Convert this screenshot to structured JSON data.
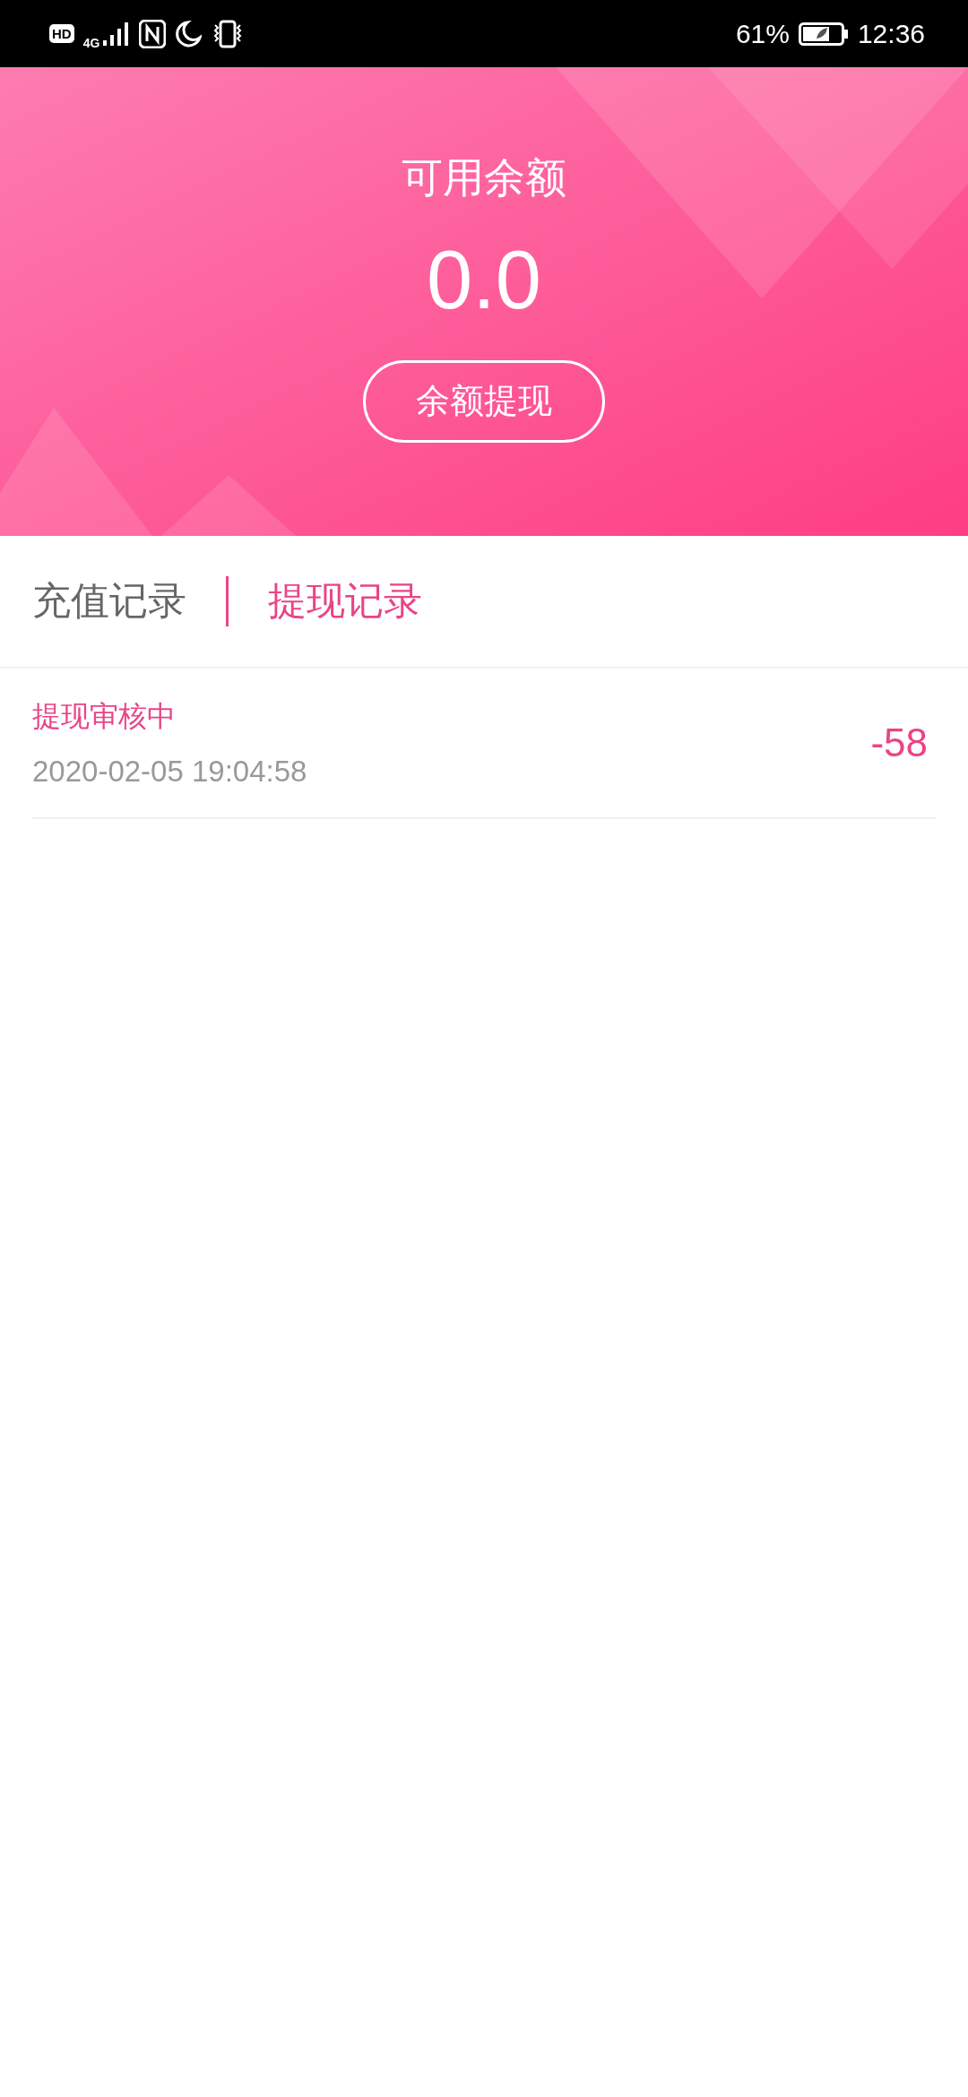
{
  "status_bar": {
    "network_badge": "HD",
    "network_type": "4G",
    "battery": "61%",
    "time": "12:36"
  },
  "balance": {
    "title": "可用余额",
    "amount": "0.0",
    "withdraw_button": "余额提现"
  },
  "tabs": [
    {
      "label": "充值记录",
      "selected": false
    },
    {
      "label": "提现记录",
      "selected": true
    }
  ],
  "records": [
    {
      "status": "提现审核中",
      "time": "2020-02-05 19:04:58",
      "amount": "-58"
    }
  ]
}
